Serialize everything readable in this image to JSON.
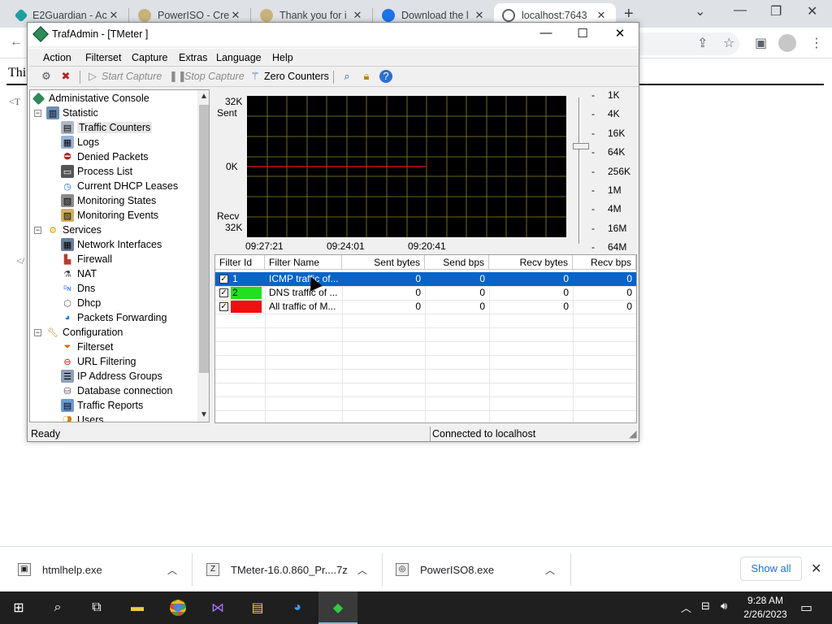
{
  "browser": {
    "tabs": [
      {
        "title": "E2Guardian - Ac",
        "icon_color": "#1ca0a0"
      },
      {
        "title": "PowerISO - Crea",
        "icon_color": "#c9b27a"
      },
      {
        "title": "Thank you for i",
        "icon_color": "#c9b27a"
      },
      {
        "title": "Download the l",
        "icon_color": "#1a73e8"
      },
      {
        "title": "localhost:7643",
        "icon_color": "#5f6368"
      }
    ],
    "new_tab": "+",
    "page_text_1": "Thi",
    "page_text_2": "<T",
    "page_text_3": "</"
  },
  "window": {
    "title": "TrafAdmin - [TMeter ]",
    "menu": [
      "Action",
      "Filterset",
      "Capture",
      "Extras",
      "Language",
      "Help"
    ],
    "toolbar": {
      "start_capture": "Start Capture",
      "stop_capture": "Stop Capture",
      "zero_counters": "Zero Counters"
    }
  },
  "tree": {
    "root": "Administative Console",
    "statistic": "Statistic",
    "statistic_items": [
      "Traffic Counters",
      "Logs",
      "Denied Packets",
      "Process List",
      "Current DHCP Leases",
      "Monitoring States",
      "Monitoring Events"
    ],
    "services": "Services",
    "services_items": [
      "Network Interfaces",
      "Firewall",
      "NAT",
      "Dns",
      "Dhcp",
      "Packets Forwarding"
    ],
    "configuration": "Configuration",
    "configuration_items": [
      "Filterset",
      "URL Filtering",
      "IP Address Groups",
      "Database connection",
      "Traffic Reports",
      "Users"
    ]
  },
  "graph": {
    "sent_label": "Sent",
    "recv_label": "Recv",
    "top_value": "32K",
    "mid_value": "0K",
    "bottom_value": "32K",
    "time_labels": [
      "09:27:21",
      "09:24:01",
      "09:20:41"
    ],
    "scale": [
      "1K",
      "4K",
      "16K",
      "64K",
      "256K",
      "1M",
      "4M",
      "16M",
      "64M"
    ],
    "line_color": "#d22020",
    "grid_color": "#8a8a2a"
  },
  "table": {
    "headers": [
      "Filter Id",
      "Filter Name",
      "Sent bytes",
      "Send bps",
      "Recv bytes",
      "Recv bps"
    ],
    "rows": [
      {
        "id": "1",
        "name": "ICMP traffic of...",
        "sent": "0",
        "send_bps": "0",
        "recv": "0",
        "recv_bps": "0",
        "color": "#0a64c8",
        "selected": true
      },
      {
        "id": "2",
        "name": "DNS traffic of ...",
        "sent": "0",
        "send_bps": "0",
        "recv": "0",
        "recv_bps": "0",
        "color": "#20e020",
        "selected": false
      },
      {
        "id": "3",
        "name": "All traffic of M...",
        "sent": "0",
        "send_bps": "0",
        "recv": "0",
        "recv_bps": "0",
        "color": "#ee1010",
        "selected": false
      }
    ]
  },
  "status": {
    "left": "Ready",
    "right": "Connected to localhost"
  },
  "downloads": {
    "items": [
      "htmlhelp.exe",
      "TMeter-16.0.860_Pr....7z",
      "PowerISO8.exe"
    ],
    "show_all": "Show all"
  },
  "taskbar": {
    "time": "9:28 AM",
    "date": "2/26/2023"
  }
}
